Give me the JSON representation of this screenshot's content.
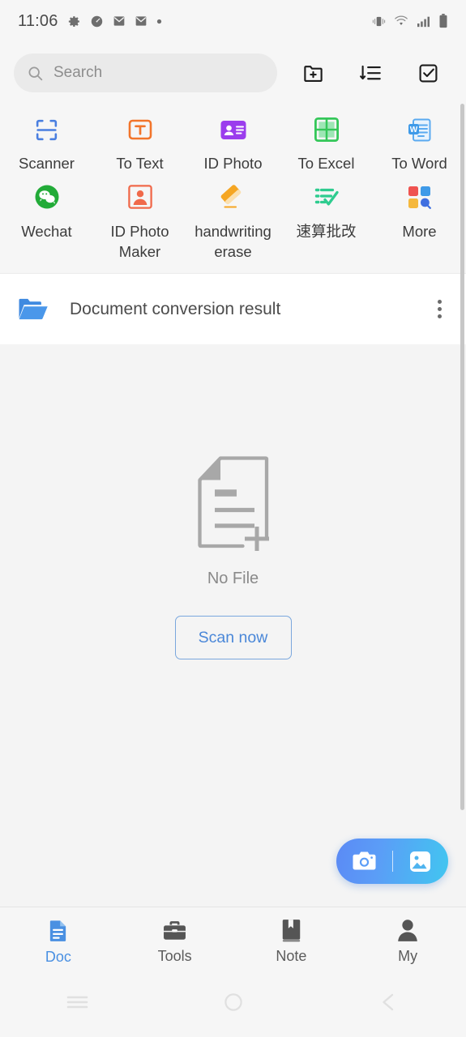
{
  "statusbar": {
    "time": "11:06",
    "left_icons": [
      "settings-gear-icon",
      "speedometer-icon",
      "mail-icon",
      "mail-icon",
      "dot-icon"
    ],
    "right_icons": [
      "vibrate-icon",
      "wifi-icon",
      "cellular-signal-icon",
      "battery-icon"
    ]
  },
  "header": {
    "search_placeholder": "Search",
    "search_value": "",
    "actions": [
      {
        "name": "new-folder-icon"
      },
      {
        "name": "sort-icon"
      },
      {
        "name": "select-checkbox-icon"
      }
    ]
  },
  "tools": {
    "row1": [
      {
        "label": "Scanner",
        "icon": "scanner-frame-icon",
        "color": "#4a7fe0"
      },
      {
        "label": "To Text",
        "icon": "text-t-icon",
        "color": "#f2752b"
      },
      {
        "label": "ID Photo",
        "icon": "id-card-icon",
        "color": "#9b3ded"
      },
      {
        "label": "To Excel",
        "icon": "excel-grid-icon",
        "color": "#34c759"
      },
      {
        "label": "To Word",
        "icon": "word-doc-icon",
        "color": "#3f9ae8"
      }
    ],
    "row2": [
      {
        "label": "Wechat",
        "icon": "wechat-icon",
        "color": "#22ab38"
      },
      {
        "label": "ID Photo Maker",
        "icon": "person-frame-icon",
        "color": "#f0694a"
      },
      {
        "label": "handwriting erase",
        "icon": "eraser-icon",
        "color": "#f5a623"
      },
      {
        "label": "速算批改",
        "icon": "checklist-check-icon",
        "color": "#2ecc8f"
      },
      {
        "label": "More",
        "icon": "more-grid-icon",
        "color": "#4a90e2"
      }
    ]
  },
  "folder": {
    "name": "Document conversion result",
    "icon": "open-folder-icon",
    "menu_icon": "more-vertical-icon"
  },
  "empty_state": {
    "icon": "document-add-icon",
    "message": "No File",
    "button_label": "Scan now"
  },
  "fab": {
    "camera_icon": "camera-icon",
    "gallery_icon": "image-icon"
  },
  "bottom_nav": [
    {
      "label": "Doc",
      "icon": "document-icon",
      "active": true
    },
    {
      "label": "Tools",
      "icon": "toolbox-icon",
      "active": false
    },
    {
      "label": "Note",
      "icon": "book-bookmark-icon",
      "active": false
    },
    {
      "label": "My",
      "icon": "person-icon",
      "active": false
    }
  ],
  "system_nav": [
    {
      "name": "recents-button",
      "icon": "hamburger-icon"
    },
    {
      "name": "home-button",
      "icon": "circle-icon"
    },
    {
      "name": "back-button",
      "icon": "chevron-left-icon"
    }
  ],
  "colors": {
    "accent": "#4a90e2",
    "page_bg": "#f6f6f6",
    "card_bg": "#ffffff"
  }
}
